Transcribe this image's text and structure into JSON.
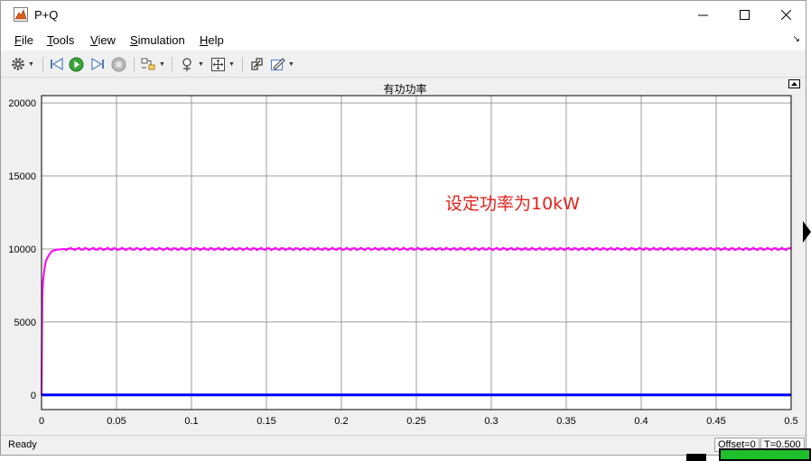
{
  "window": {
    "title": "P+Q"
  },
  "menu": {
    "file": {
      "key": "F",
      "rest": "ile"
    },
    "tools": {
      "key": "T",
      "rest": "ools"
    },
    "view": {
      "key": "V",
      "rest": "iew"
    },
    "simulation": {
      "key": "S",
      "rest": "imulation"
    },
    "help": {
      "key": "H",
      "rest": "elp"
    }
  },
  "toolbar": {
    "icons": [
      "gear-icon",
      "step-back-icon",
      "run-icon",
      "step-forward-icon",
      "stop-icon",
      "signal-selector-icon",
      "zoom-icon",
      "autoscale-icon",
      "highlight-icon",
      "style-icon"
    ]
  },
  "colors": {
    "series_active": "#ff00ff",
    "series_reactive": "#0000ff",
    "annotation": "#e0221b"
  },
  "plot": {
    "title": "有功功率",
    "annotation": "设定功率为10kW",
    "y_ticks": [
      "20000",
      "15000",
      "10000",
      "5000",
      "0"
    ],
    "x_ticks": [
      "0",
      "0.05",
      "0.1",
      "0.15",
      "0.2",
      "0.25",
      "0.3",
      "0.35",
      "0.4",
      "0.45",
      "0.5"
    ]
  },
  "chart_data": {
    "type": "line",
    "title": "有功功率",
    "xlabel": "",
    "ylabel": "",
    "xlim": [
      0,
      0.5
    ],
    "ylim": [
      -1000,
      20500
    ],
    "grid": true,
    "series": [
      {
        "color": "#ff00ff",
        "x": [
          0,
          0.0005,
          0.001,
          0.002,
          0.003,
          0.005,
          0.007,
          0.01,
          0.015,
          0.02,
          0.05,
          0.1,
          0.2,
          0.3,
          0.4,
          0.5
        ],
        "values": [
          0,
          6800,
          7800,
          8700,
          9200,
          9600,
          9850,
          9950,
          10000,
          10000,
          10000,
          10000,
          10000,
          10000,
          10000,
          10000
        ]
      },
      {
        "color": "#0000ff",
        "x": [
          0,
          0.5
        ],
        "values": [
          0,
          0
        ]
      }
    ]
  },
  "status": {
    "ready": "Ready",
    "offset": "Offset=0",
    "time": "T=0.500"
  }
}
